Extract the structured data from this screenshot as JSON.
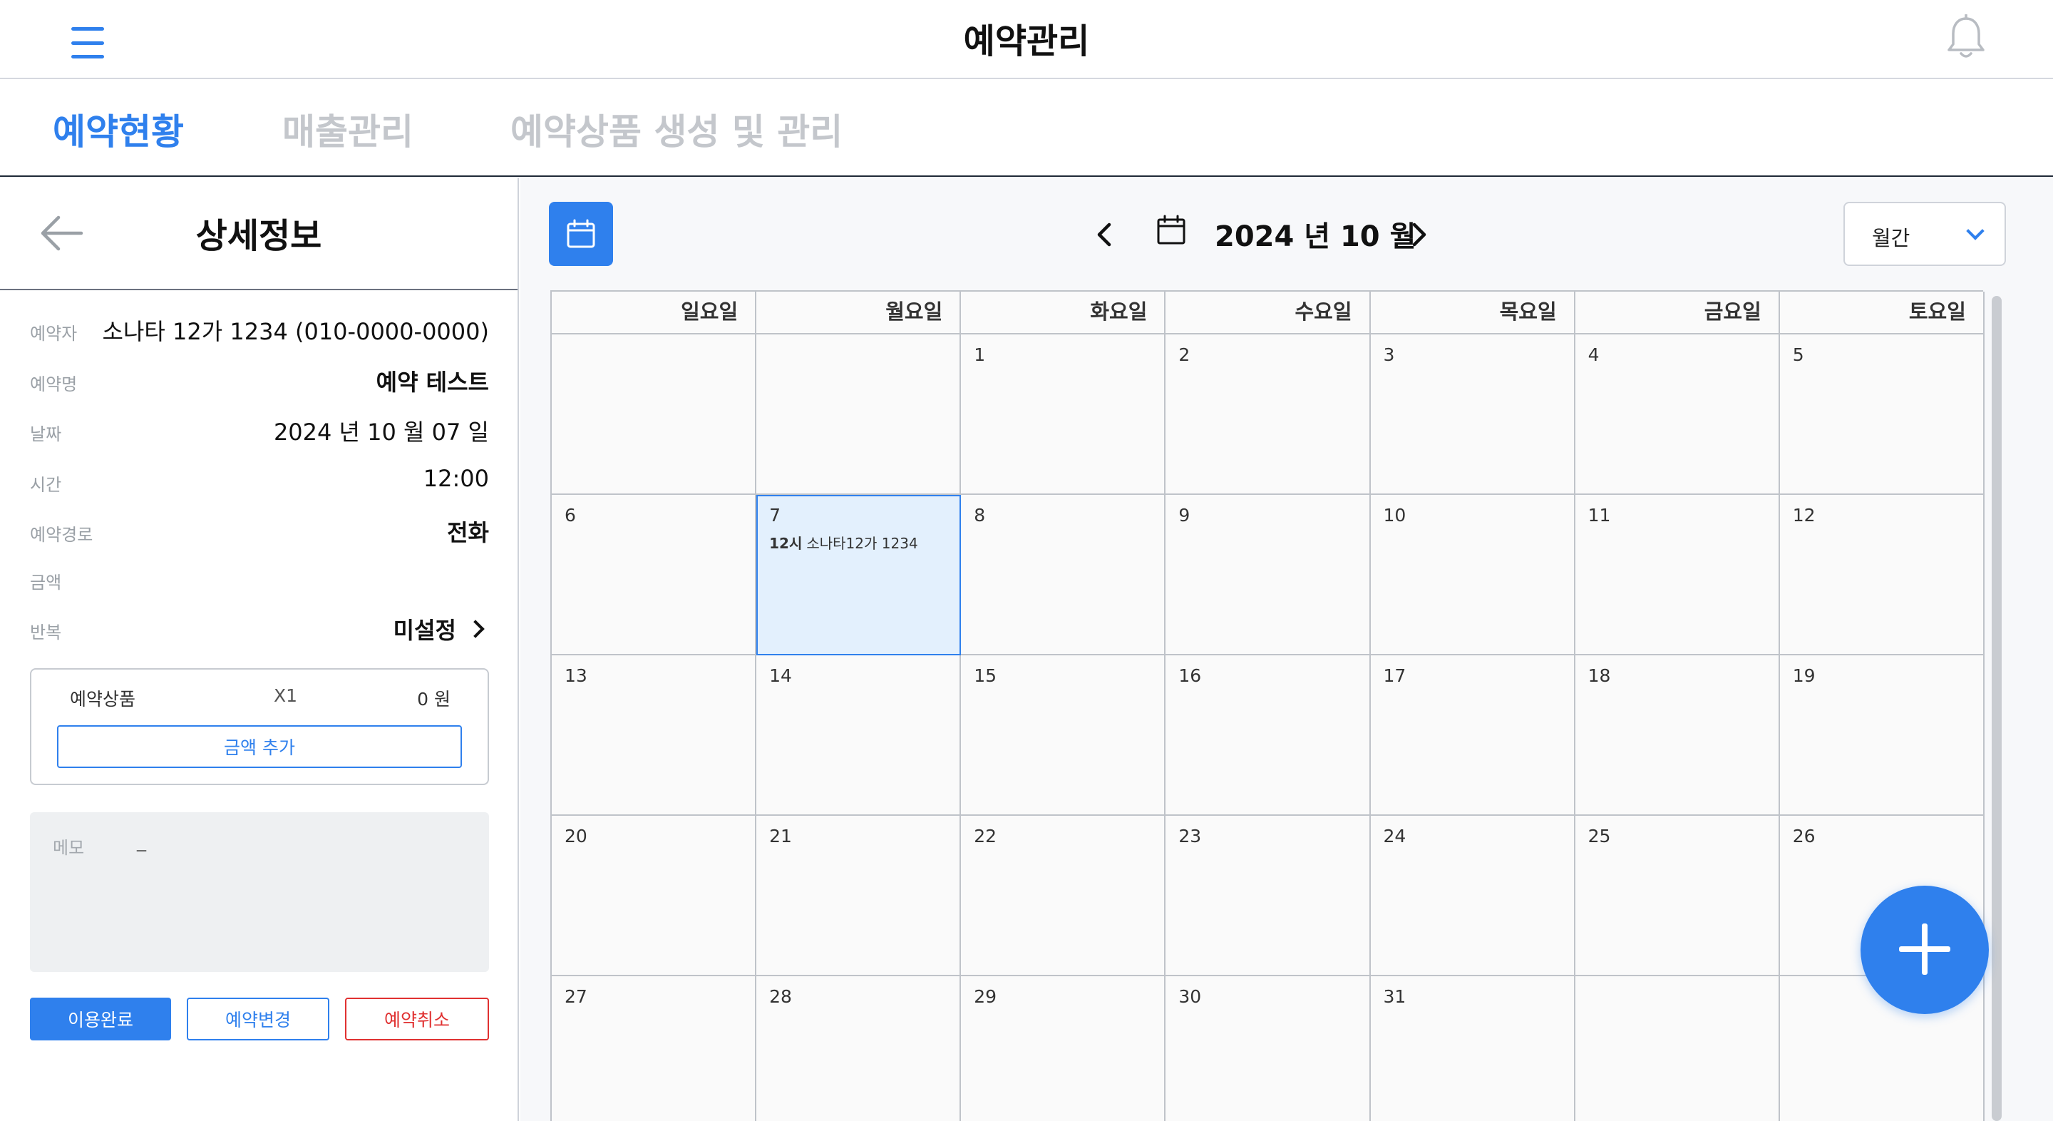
{
  "header": {
    "title": "예약관리"
  },
  "tabs": [
    {
      "label": "예약현황",
      "active": true
    },
    {
      "label": "매출관리",
      "active": false
    },
    {
      "label": "예약상품 생성 및 관리",
      "active": false
    }
  ],
  "detail": {
    "title": "상세정보",
    "rows": [
      {
        "key": "예약자",
        "value": "소나타 12가 1234 (010-0000-0000)"
      },
      {
        "key": "예약명",
        "value": "예약 테스트"
      },
      {
        "key": "날짜",
        "value": "2024 년 10 월 07 일"
      },
      {
        "key": "시간",
        "value": "12:00"
      },
      {
        "key": "예약경로",
        "value": "전화"
      },
      {
        "key": "금액",
        "value": ""
      },
      {
        "key": "반복",
        "value": "미설정"
      }
    ],
    "product": {
      "name": "예약상품",
      "qty": "X1",
      "price": "0 원",
      "add_label": "금액 추가"
    },
    "memo": {
      "label": "메모",
      "value": "_"
    },
    "buttons": {
      "done": "이용완료",
      "change": "예약변경",
      "cancel": "예약취소"
    }
  },
  "calendar": {
    "month_label": "2024 년  10 월",
    "view_label": "월간",
    "weekdays": [
      "일요일",
      "월요일",
      "화요일",
      "수요일",
      "목요일",
      "금요일",
      "토요일"
    ],
    "cells": [
      "",
      "",
      "1",
      "2",
      "3",
      "4",
      "5",
      "6",
      "7",
      "8",
      "9",
      "10",
      "11",
      "12",
      "13",
      "14",
      "15",
      "16",
      "17",
      "18",
      "19",
      "20",
      "21",
      "22",
      "23",
      "24",
      "25",
      "26",
      "27",
      "28",
      "29",
      "30",
      "31",
      "",
      ""
    ],
    "selected_day": "7",
    "events": [
      {
        "day": "7",
        "time": "12시",
        "text": "소나타12가 1234"
      }
    ]
  },
  "colors": {
    "accent": "#2f80ed",
    "danger": "#e03131",
    "selected_bg": "#e3f0fd"
  }
}
